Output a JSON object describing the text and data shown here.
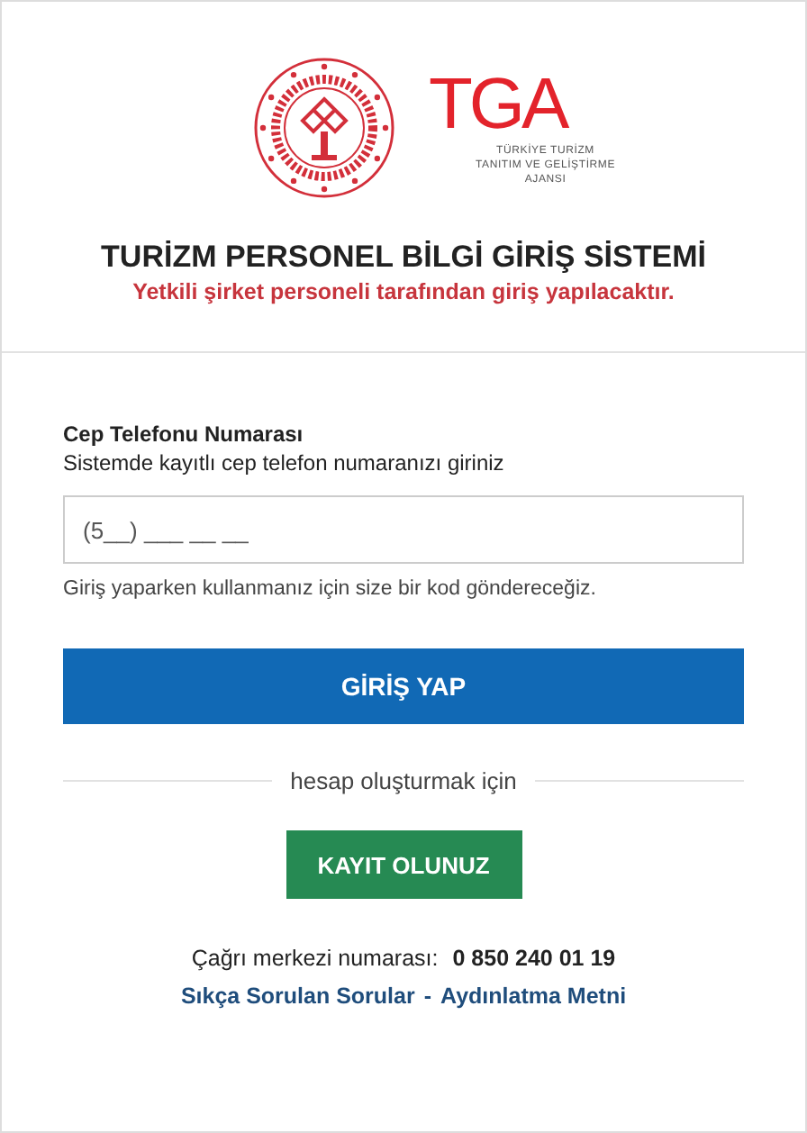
{
  "header": {
    "logo_text": "TGA",
    "logo_caption": [
      "TÜRKİYE TURİZM",
      "TANITIM VE GELİŞTİRME",
      "AJANSI"
    ],
    "title": "TURİZM PERSONEL BİLGİ GİRİŞ SİSTEMİ",
    "subtitle": "Yetkili şirket personeli tarafından giriş yapılacaktır."
  },
  "form": {
    "label": "Cep Telefonu Numarası",
    "description": "Sistemde kayıtlı cep telefon numaranızı giriniz",
    "placeholder": "(5__) ___ __ __",
    "hint": "Giriş yaparken kullanmanız için size bir kod göndereceğiz.",
    "login_button": "GİRİŞ YAP",
    "divider_text": "hesap oluşturmak için",
    "register_button": "KAYIT OLUNUZ"
  },
  "footer": {
    "call_center_label": "Çağrı merkezi numarası:",
    "call_center_number": "0 850 240 01 19",
    "links": [
      "Sıkça Sorulan Sorular",
      "Aydınlatma Metni"
    ],
    "separator": "-"
  }
}
